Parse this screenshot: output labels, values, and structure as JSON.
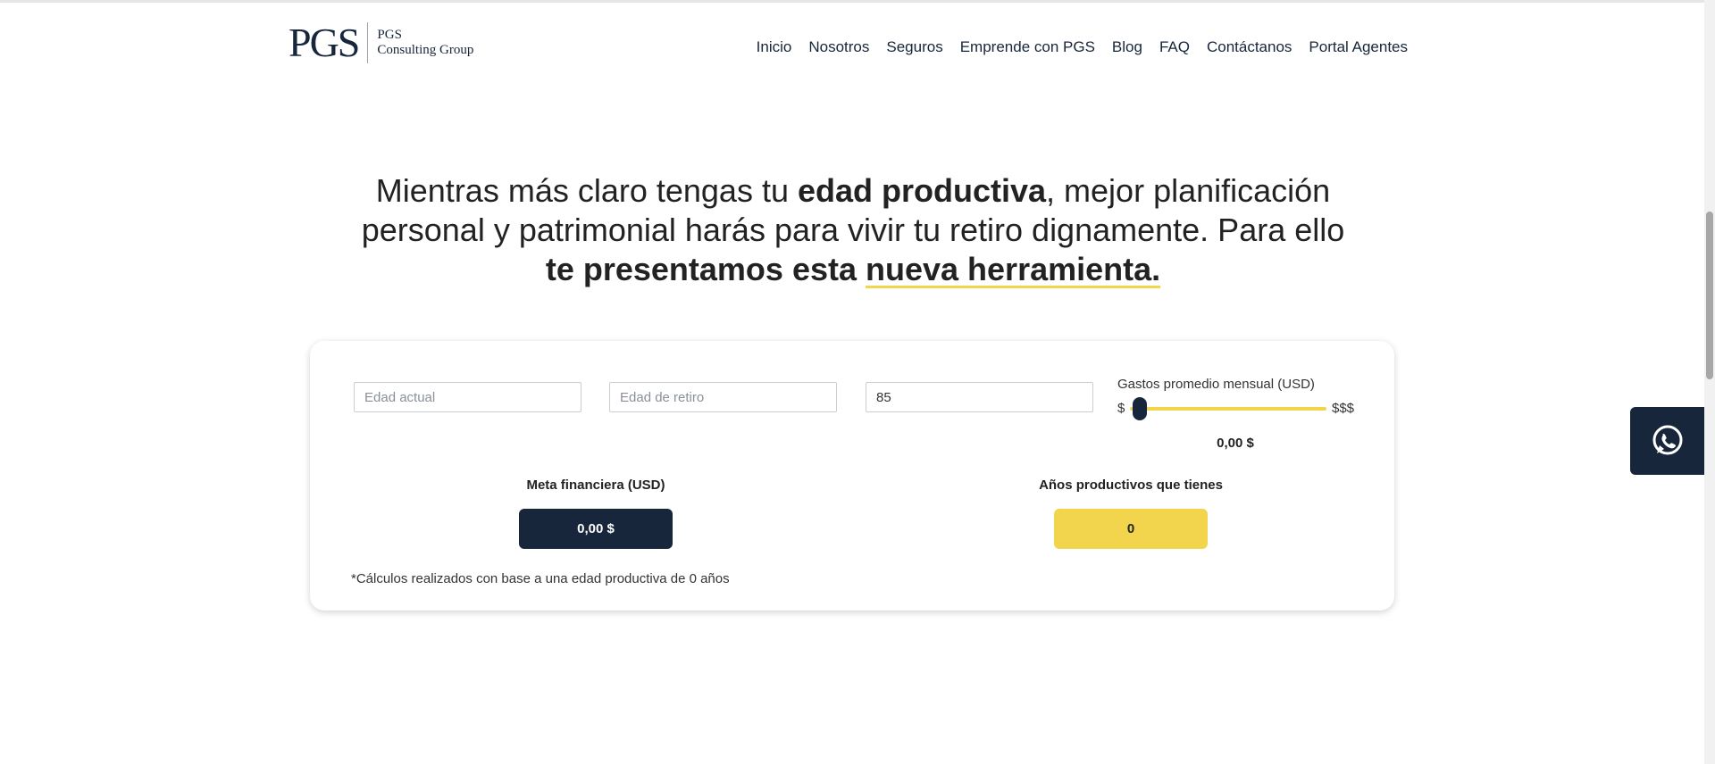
{
  "logo": {
    "mark": "PGS",
    "line1": "PGS",
    "line2": "Consulting Group"
  },
  "nav": [
    "Inicio",
    "Nosotros",
    "Seguros",
    "Emprende con PGS",
    "Blog",
    "FAQ",
    "Contáctanos",
    "Portal Agentes"
  ],
  "headline": {
    "part1": "Mientras más claro tengas tu ",
    "bold1": "edad productiva",
    "part2": ", mejor planificación personal y patrimonial harás para vivir tu retiro dignamente. Para ello ",
    "bold2": "te presentamos esta ",
    "bold_underline": "nueva herramienta."
  },
  "calculator": {
    "current_age_placeholder": "Edad actual",
    "retirement_age_placeholder": "Edad de retiro",
    "life_expectancy_value": "85",
    "slider": {
      "title": "Gastos promedio mensual (USD)",
      "min_label": "$",
      "max_label": "$$$",
      "value": "0,00 $",
      "level": 0
    },
    "goal_label": "Meta financiera (USD)",
    "goal_value": "0,00 $",
    "years_label": "Años productivos que tienes",
    "years_value": "0",
    "footnote": "*Cálculos realizados con base a una edad productiva de 0 años"
  },
  "colors": {
    "navy": "#17263a",
    "yellow": "#f2d54c"
  },
  "whatsapp": {
    "icon": "whatsapp-icon"
  }
}
